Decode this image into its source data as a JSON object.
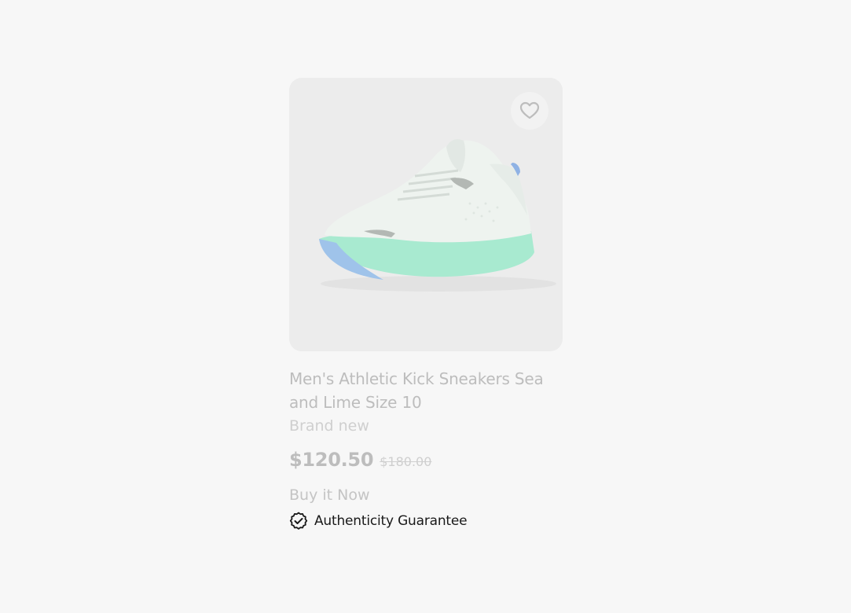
{
  "listing": {
    "title": "Men's Athletic Kick Sneakers Sea and Lime Size 10",
    "condition": "Brand new",
    "price": "$120.50",
    "original_price": "$180.00",
    "buy_format": "Buy it Now",
    "authenticity_label": "Authenticity Guarantee",
    "favorite_icon": "heart-icon",
    "verified_icon": "verified-badge-icon"
  },
  "colors": {
    "background": "#f7f7f7",
    "image_background": "#ececec",
    "muted_text": "#bdbdbd",
    "accent_sole": "#a6e8c9",
    "text_dark": "#191919"
  }
}
